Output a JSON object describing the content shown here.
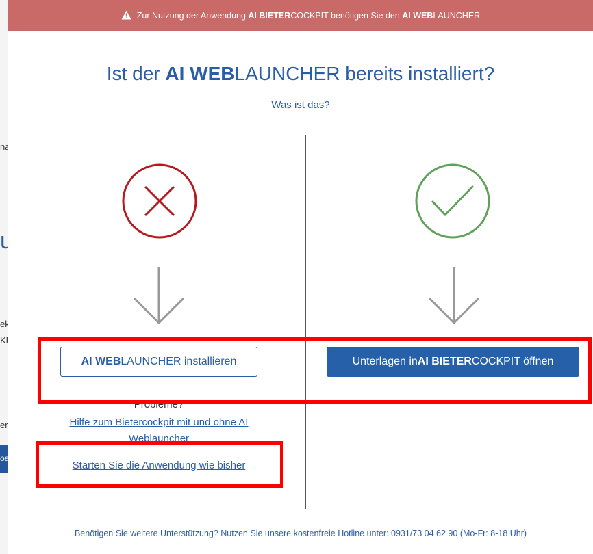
{
  "background": {
    "fragments": [
      "na",
      "ek",
      "KF",
      "er",
      "oa"
    ],
    "big_letter": "u"
  },
  "banner": {
    "icon": "warning-triangle-icon",
    "text_prefix": "Zur Nutzung der Anwendung ",
    "bold1": "AI BIETER",
    "text1": "COCKPIT benötigen Sie den ",
    "bold2": "AI WEB",
    "text2": "LAUNCHER"
  },
  "title": {
    "prefix": "Ist der ",
    "bold": "AI WEB",
    "suffix": "LAUNCHER bereits installiert?"
  },
  "what_link": "Was ist das?",
  "left": {
    "icon": "x-circle-icon",
    "install_button": {
      "bold": "AI WEB",
      "rest": "LAUNCHER installieren"
    },
    "problems": "Probleme?",
    "help_link": "Hilfe zum Bietercockpit mit und ohne AI Weblauncher",
    "start_link": "Starten Sie die Anwendung wie bisher"
  },
  "right": {
    "icon": "check-circle-icon",
    "open_button": {
      "prefix": "Unterlagen in ",
      "bold": "AI BIETER",
      "rest": "COCKPIT öffnen"
    }
  },
  "footer": "Benötigen Sie weitere Unterstützung? Nutzen Sie unsere kostenfreie Hotline unter: 0931/73 04 62 90 (Mo-Fr: 8-18 Uhr)",
  "colors": {
    "banner_bg": "#c96a68",
    "brand_blue": "#2a5fa8",
    "error_red": "#b5191b",
    "success_green": "#5fa05a",
    "highlight_red": "#ff0000"
  }
}
